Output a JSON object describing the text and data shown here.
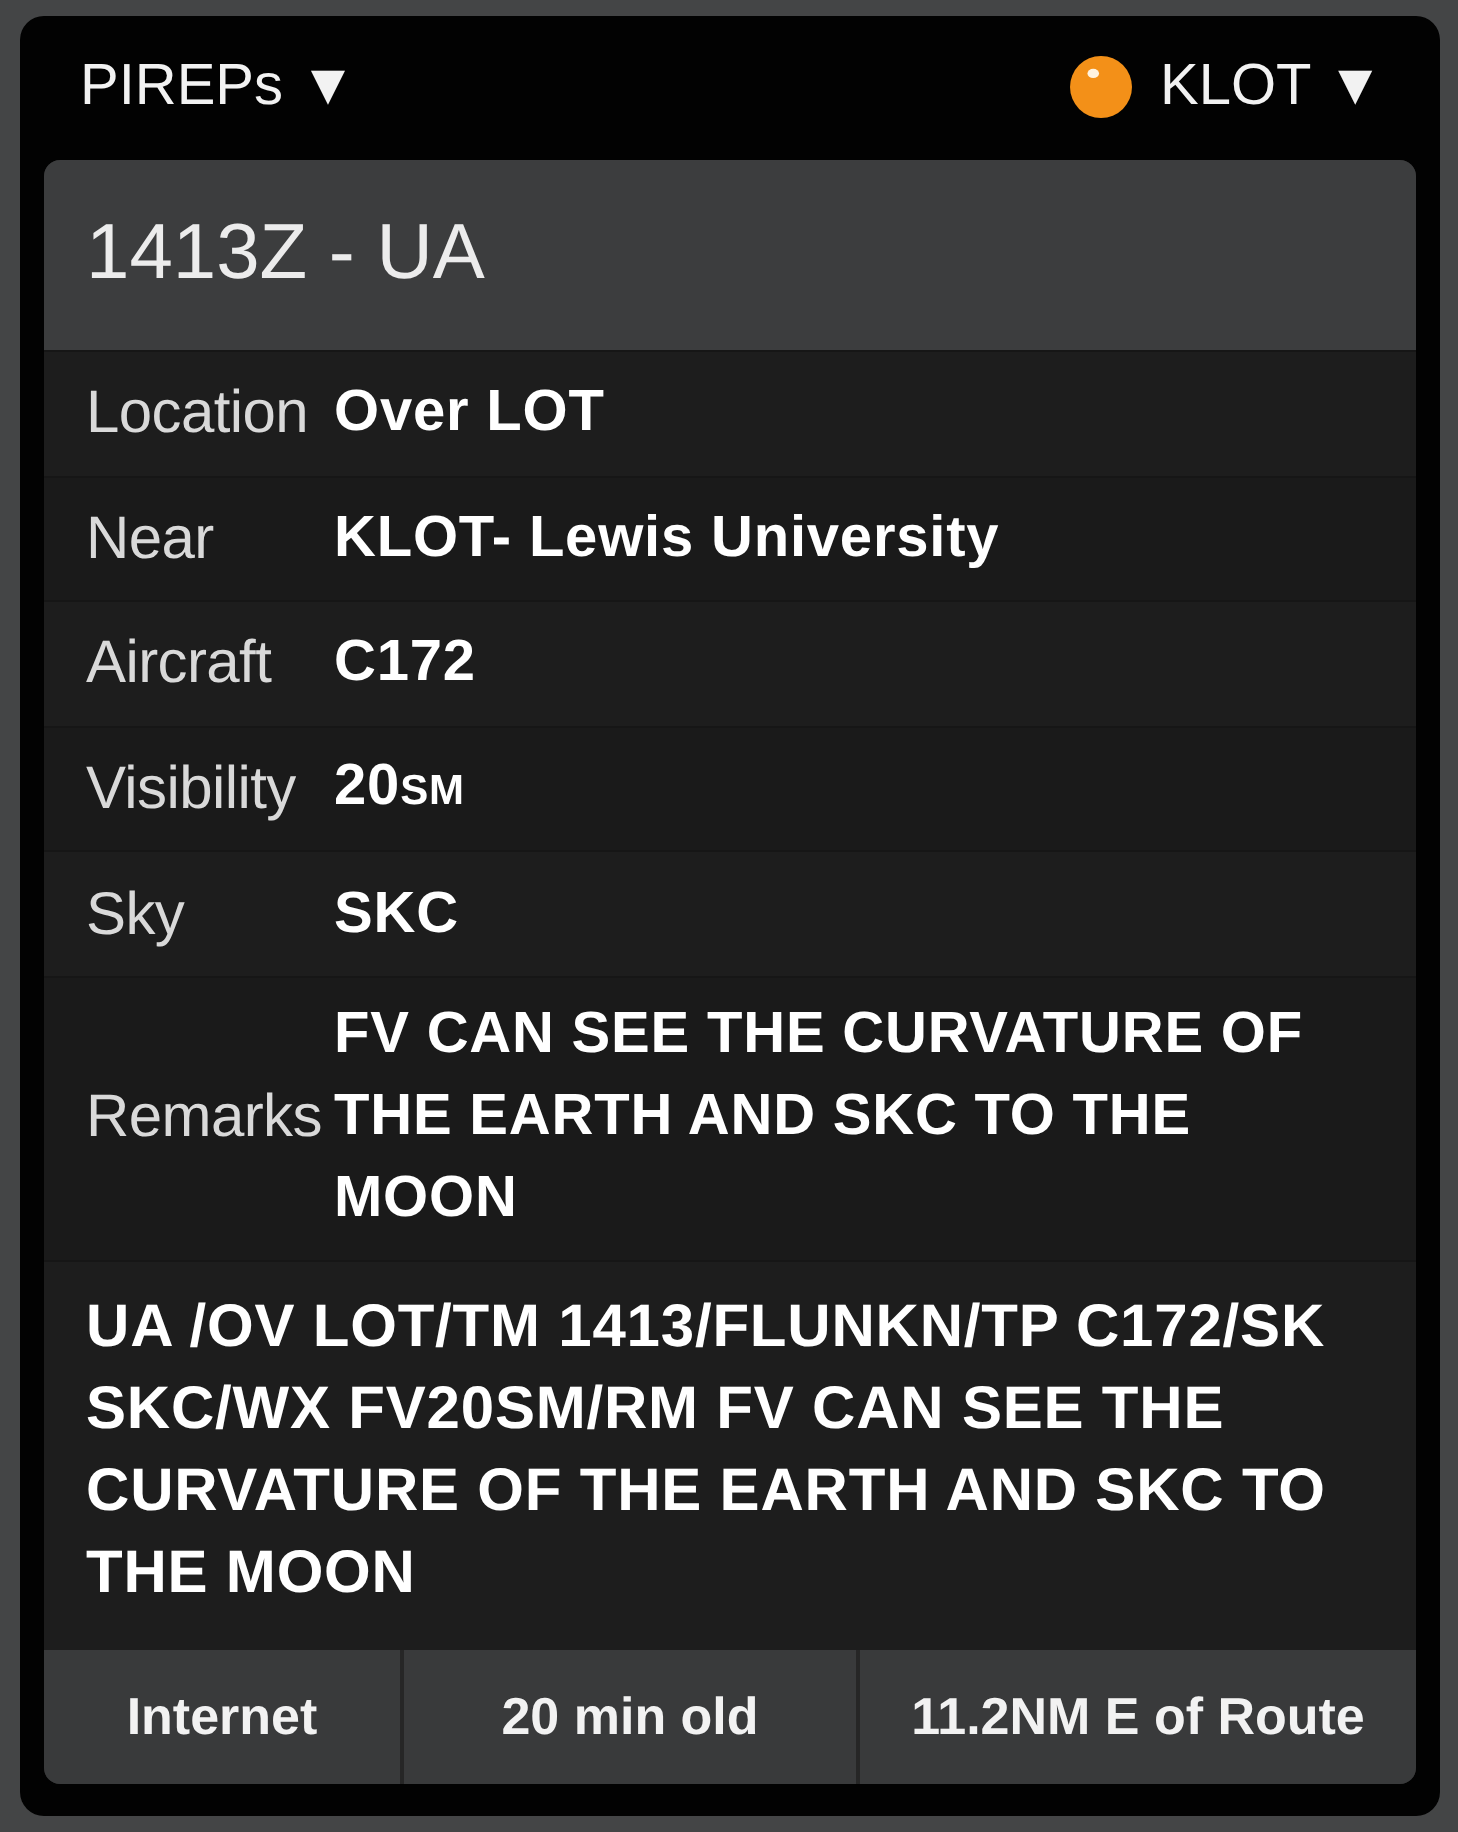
{
  "header": {
    "menu": "PIREPs ▼",
    "station": {
      "color": "#f39018",
      "label": "KLOT ▼"
    }
  },
  "report": {
    "title": "1413Z - UA",
    "fields": [
      {
        "label": "Location",
        "value": "Over LOT"
      },
      {
        "label": "Near",
        "value": "KLOT- Lewis University"
      },
      {
        "label": "Aircraft",
        "value": "C172"
      },
      {
        "label": "Visibility",
        "value": "20",
        "unit": "SM"
      },
      {
        "label": "Sky",
        "value": "SKC"
      },
      {
        "label": "Remarks",
        "value": "FV CAN SEE THE CURVATURE OF THE EARTH AND SKC TO THE MOON"
      }
    ],
    "raw": "UA /OV LOT/TM 1413/FLUNKN/TP C172/SK SKC/WX FV20SM/RM FV CAN SEE THE CURVATURE OF THE EARTH AND SKC TO THE MOON",
    "footer": [
      "Internet",
      "20 min old",
      "11.2NM E of Route"
    ]
  }
}
